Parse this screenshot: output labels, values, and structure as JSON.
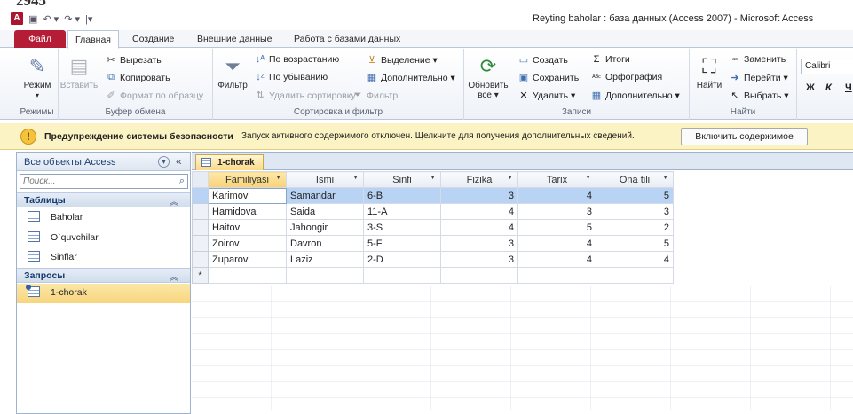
{
  "window": {
    "partial_text": "2945",
    "title": "Reyting baholar : база данных (Access 2007) - Microsoft Access",
    "app_icon": "A"
  },
  "tabs": [
    {
      "label": "Файл"
    },
    {
      "label": "Главная"
    },
    {
      "label": "Создание"
    },
    {
      "label": "Внешние данные"
    },
    {
      "label": "Работа с базами данных"
    }
  ],
  "ribbon": {
    "views": {
      "label": "Режимы",
      "mode_button": "Режим"
    },
    "clipboard": {
      "label": "Буфер обмена",
      "paste": "Вставить",
      "cut": "Вырезать",
      "copy": "Копировать",
      "format_painter": "Формат по образцу"
    },
    "sort_filter": {
      "label": "Сортировка и фильтр",
      "filter": "Фильтр",
      "asc": "По возрастанию",
      "desc": "По убыванию",
      "remove_sort": "Удалить сортировку",
      "selection": "Выделение ▾",
      "advanced": "Дополнительно ▾",
      "toggle_filter": "Фильтр"
    },
    "records": {
      "label": "Записи",
      "refresh": "Обновить все ▾",
      "new": "Создать",
      "save": "Сохранить",
      "delete": "Удалить ▾",
      "totals": "Итоги",
      "spelling": "Орфография",
      "more": "Дополнительно ▾"
    },
    "find": {
      "label": "Найти",
      "find": "Найти",
      "replace": "Заменить",
      "goto": "Перейти ▾",
      "select": "Выбрать ▾"
    },
    "font": {
      "name": "Calibri",
      "bold": "Ж",
      "italic": "К",
      "underline": "Ч"
    }
  },
  "security": {
    "title": "Предупреждение системы безопасности",
    "message": "Запуск активного содержимого отключен. Щелкните для получения дополнительных сведений.",
    "button": "Включить содержимое"
  },
  "nav": {
    "title": "Все объекты Access",
    "search_placeholder": "Поиск...",
    "tables_header": "Таблицы",
    "tables": [
      {
        "label": "Baholar"
      },
      {
        "label": "O`quvchilar"
      },
      {
        "label": "Sinflar"
      }
    ],
    "queries_header": "Запросы",
    "queries": [
      {
        "label": "1-chorak"
      }
    ]
  },
  "document": {
    "tab_label": "1-chorak",
    "columns": [
      "Familiyasi",
      "Ismi",
      "Sinfi",
      "Fizika",
      "Tarix",
      "Ona tili"
    ],
    "rows": [
      [
        "Karimov",
        "Samandar",
        "6-B",
        "3",
        "4",
        "5"
      ],
      [
        "Hamidova",
        "Saida",
        "11-A",
        "4",
        "3",
        "3"
      ],
      [
        "Haitov",
        "Jahongir",
        "3-S",
        "4",
        "5",
        "2"
      ],
      [
        "Zoirov",
        "Davron",
        "5-F",
        "3",
        "4",
        "5"
      ],
      [
        "Zuparov",
        "Laziz",
        "2-D",
        "3",
        "4",
        "4"
      ]
    ],
    "new_row_marker": "*"
  }
}
